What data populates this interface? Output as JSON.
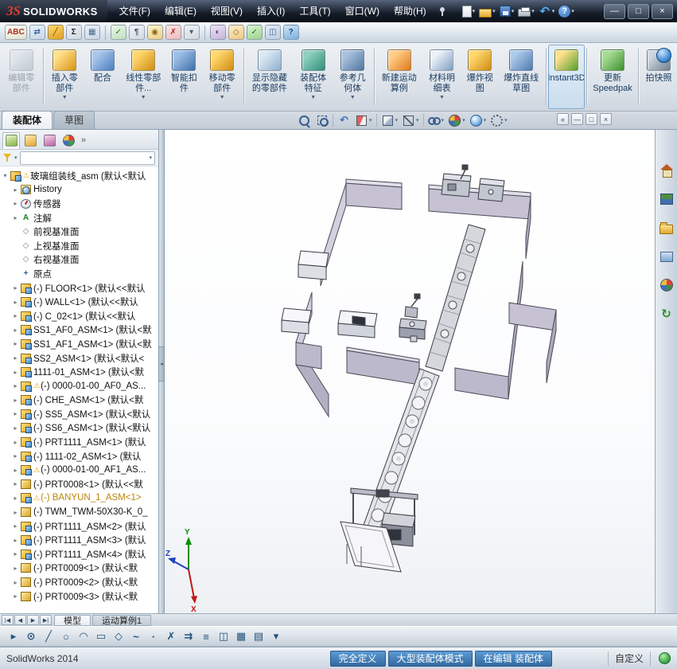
{
  "glyphs": {
    "expand": "▸",
    "expanded": "▾",
    "warning": "⚠",
    "dropdown": "▼",
    "small_dropdown": "▾",
    "overflow": "»",
    "splitter": "◂"
  },
  "titlebar": {
    "logo_mark": "ЗS",
    "logo_text": "SOLIDWORKS",
    "menus": [
      "文件(F)",
      "编辑(E)",
      "视图(V)",
      "插入(I)",
      "工具(T)",
      "窗口(W)",
      "帮助(H)"
    ],
    "quick_tools": [
      {
        "name": "new-document-icon",
        "cls": "qi-new",
        "dropdown": true
      },
      {
        "name": "open-document-icon",
        "cls": "qi-open",
        "dropdown": true
      },
      {
        "name": "save-icon",
        "cls": "qi-save",
        "dropdown": true
      },
      {
        "name": "print-icon",
        "cls": "qi-print",
        "dropdown": true
      },
      {
        "name": "undo-icon",
        "cls": "qi-undo",
        "glyph": "↶",
        "dropdown": true
      },
      {
        "name": "help-icon",
        "cls": "qi-help",
        "glyph": "?",
        "dropdown": true
      }
    ],
    "window_buttons": [
      {
        "name": "minimize-button",
        "glyph": "—"
      },
      {
        "name": "maximize-button",
        "glyph": "□"
      },
      {
        "name": "close-button",
        "glyph": "×"
      }
    ]
  },
  "toolbar2": {
    "icons": [
      {
        "name": "spell-checker-icon",
        "glyph": "ABC",
        "bg": "#fbfbf4",
        "bg2": "#e2e2d2",
        "fg": "#b03020"
      },
      {
        "name": "translate-icon",
        "glyph": "⇄",
        "bg": "#eaf0f8",
        "bg2": "#c8d6e6",
        "fg": "#2f5f9f"
      },
      {
        "name": "measure-icon",
        "glyph": "╱",
        "bg": "#ffd86e",
        "bg2": "#e0a020",
        "fg": "#7a4a00"
      },
      {
        "name": "mass-properties-icon",
        "glyph": "Σ",
        "bg": "#f0f3f7",
        "bg2": "#cfd8e2",
        "fg": "#222222"
      },
      {
        "name": "performance-evaluation-icon",
        "glyph": "▦",
        "bg": "#eaf0f8",
        "bg2": "#c8d6e6",
        "fg": "#4a6a8a"
      },
      {
        "sep": true
      },
      {
        "name": "verification-icon",
        "glyph": "✓",
        "bg": "#eaf6ea",
        "bg2": "#bfe0bf",
        "fg": "#1f7f1f"
      },
      {
        "name": "statistics-icon",
        "glyph": "¶",
        "bg": "#f2f4f7",
        "bg2": "#d4dbe2",
        "fg": "#44566a"
      },
      {
        "name": "interference-detection-icon",
        "glyph": "◉",
        "bg": "#fff3d0",
        "bg2": "#eccf8a",
        "fg": "#8a6a10"
      },
      {
        "name": "clearance-check-icon",
        "glyph": "✗",
        "bg": "#fbe4e4",
        "bg2": "#eebcbc",
        "fg": "#b02020"
      },
      {
        "name": "selection-options-icon",
        "glyph": "▾",
        "bg": "#eef1f5",
        "bg2": "#d2d9e0",
        "fg": "#4a5a6a"
      },
      {
        "sep": true
      },
      {
        "name": "appearance-filter-icon",
        "glyph": "◐",
        "bg": "#ece4f4",
        "bg2": "#c8b4dc",
        "fg": "#5a3a7a"
      },
      {
        "name": "assembly-transparency-icon",
        "glyph": "◇",
        "bg": "#fdeecb",
        "bg2": "#eeca84",
        "fg": "#8a5a10"
      },
      {
        "name": "check-active-document-icon",
        "glyph": "✓",
        "bg": "#d8f2d0",
        "bg2": "#9fd48e",
        "fg": "#1f6f1f"
      },
      {
        "name": "compare-documents-icon",
        "glyph": "◫",
        "bg": "#e4ecf6",
        "bg2": "#bcCEe4",
        "fg": "#3f5f8f"
      },
      {
        "name": "quick-tips-icon",
        "glyph": "?",
        "bg": "#cfe6f8",
        "bg2": "#7fb0dc",
        "fg": "#114a7f"
      }
    ]
  },
  "ribbon": {
    "buttons": [
      {
        "id": "edit-component",
        "label": "编辑零部件",
        "c1": "#d8dfe6",
        "c2": "#98a6b2",
        "disabled": true,
        "sep": true
      },
      {
        "id": "insert-components",
        "label": "插入零部件",
        "c1": "#ffe089",
        "c2": "#d89416",
        "dropdown": true
      },
      {
        "id": "mate",
        "label": "配合",
        "c1": "#a9c7ea",
        "c2": "#4a7fc0"
      },
      {
        "id": "linear-component-pattern",
        "label": "线性零部件...",
        "c1": "#ffd86e",
        "c2": "#cf8c12",
        "dropdown": true
      },
      {
        "id": "smart-fasteners",
        "label": "智能扣件",
        "c1": "#9fc0e8",
        "c2": "#3f6fa8"
      },
      {
        "id": "move-component",
        "label": "移动零部件",
        "c1": "#ffd86e",
        "c2": "#cf8c12",
        "dropdown": true,
        "sep": true
      },
      {
        "id": "show-hidden-components",
        "label": "显示隐藏的零部件",
        "c1": "#dce8f4",
        "c2": "#8fb0cc"
      },
      {
        "id": "assembly-features",
        "label": "装配体特征",
        "c1": "#8fd0c0",
        "c2": "#2f8f78",
        "dropdown": true
      },
      {
        "id": "reference-geometry",
        "label": "参考几何体",
        "c1": "#a9c0dc",
        "c2": "#50789f",
        "dropdown": true,
        "sep": true
      },
      {
        "id": "new-motion-study",
        "label": "新建运动算例",
        "c1": "#ffd089",
        "c2": "#e07818"
      },
      {
        "id": "bill-of-materials",
        "label": "材料明细表",
        "c1": "#eef2f8",
        "c2": "#7f9fc4",
        "dropdown": true
      },
      {
        "id": "exploded-view",
        "label": "爆炸视图",
        "c1": "#ffd86e",
        "c2": "#cf8c12"
      },
      {
        "id": "explode-line-sketch",
        "label": "爆炸直线草图",
        "c1": "#abc9e9",
        "c2": "#4f7ab0",
        "sep": true
      },
      {
        "id": "instant3d",
        "label": "Instant3D",
        "c1": "#ffe089",
        "c2": "#55a030",
        "active": true,
        "sep": true
      },
      {
        "id": "update-speedpak",
        "label": "更新 Speedpak",
        "c1": "#a8dc96",
        "c2": "#3f9030",
        "sep": true
      },
      {
        "id": "take-snapshot",
        "label": "拍快照",
        "c1": "#cdd5de",
        "c2": "#72818f"
      }
    ]
  },
  "tabs": {
    "document_tabs": [
      {
        "id": "assembly",
        "label": "装配体",
        "active": true
      },
      {
        "id": "sketch",
        "label": "草图",
        "active": false
      }
    ]
  },
  "viewport_toolbar": {
    "icons": [
      {
        "id": "zoom-fit",
        "name": "zoom-fit-icon"
      },
      {
        "id": "zoom-area",
        "name": "zoom-to-area-icon"
      },
      {
        "sep": true
      },
      {
        "id": "prev",
        "name": "previous-view-icon",
        "glyph": "↶"
      },
      {
        "id": "section",
        "name": "section-view-icon",
        "dropdown": true
      },
      {
        "sep": true
      },
      {
        "id": "orient",
        "name": "view-orientation-icon",
        "dropdown": true
      },
      {
        "id": "style",
        "name": "display-style-icon",
        "dropdown": true
      },
      {
        "sep": true
      },
      {
        "id": "hideshow",
        "name": "hide-show-items-icon",
        "dropdown": true
      },
      {
        "id": "appearance",
        "name": "edit-appearance-icon",
        "dropdown": true
      },
      {
        "id": "scene",
        "name": "apply-scene-icon",
        "dropdown": true
      },
      {
        "id": "settings",
        "name": "view-settings-icon",
        "dropdown": true
      }
    ]
  },
  "doc_controls": [
    {
      "name": "doc-pane-button",
      "glyph": "«"
    },
    {
      "name": "doc-minimize-button",
      "glyph": "—"
    },
    {
      "name": "doc-restore-button",
      "glyph": "□"
    },
    {
      "name": "doc-close-button",
      "glyph": "×"
    }
  ],
  "left_panel": {
    "manager_tabs": [
      {
        "name": "feature-manager-tab",
        "icon": "feature-manager-icon",
        "cls": "mi-fm",
        "active": true
      },
      {
        "name": "property-manager-tab",
        "icon": "property-manager-icon",
        "cls": "mi-pm"
      },
      {
        "name": "configuration-manager-tab",
        "icon": "configuration-manager-icon",
        "cls": "mi-cm"
      },
      {
        "name": "display-manager-tab",
        "icon": "display-manager-icon",
        "cls": "mi-dm"
      }
    ],
    "overflow": "»"
  },
  "tree": {
    "root": {
      "label": "玻璃组装线_asm (默认<默认",
      "warning": true
    },
    "icon_glyphs": {
      "annotation": "A",
      "plane": "◇",
      "origin": "+"
    },
    "items": [
      {
        "icon": "history",
        "label": "History",
        "expand": true
      },
      {
        "icon": "sensor",
        "label": "传感器",
        "expand": true
      },
      {
        "icon": "annotation",
        "label": "注解",
        "expand": true
      },
      {
        "icon": "plane",
        "label": "前视基准面"
      },
      {
        "icon": "plane",
        "label": "上视基准面"
      },
      {
        "icon": "plane",
        "label": "右视基准面"
      },
      {
        "icon": "origin",
        "label": "原点"
      },
      {
        "icon": "assembly",
        "label": "(-) FLOOR<1> (默认<<默认",
        "expand": true
      },
      {
        "icon": "assembly",
        "label": "(-) WALL<1> (默认<<默认",
        "expand": true
      },
      {
        "icon": "assembly",
        "label": "(-) C_02<1> (默认<<默认",
        "expand": true
      },
      {
        "icon": "assembly",
        "label": "SS1_AF0_ASM<1> (默认<默",
        "expand": true
      },
      {
        "icon": "assembly",
        "label": "SS1_AF1_ASM<1> (默认<默",
        "expand": true
      },
      {
        "icon": "assembly",
        "label": "SS2_ASM<1> (默认<默认<",
        "expand": true
      },
      {
        "icon": "assembly",
        "label": "1111-01_ASM<1> (默认<默",
        "expand": true
      },
      {
        "icon": "assembly",
        "label": "(-) 0000-01-00_AF0_AS...",
        "expand": true,
        "warning": true
      },
      {
        "icon": "assembly",
        "label": "(-) CHE_ASM<1> (默认<默",
        "expand": true
      },
      {
        "icon": "assembly",
        "label": "(-) SS5_ASM<1> (默认<默认",
        "expand": true
      },
      {
        "icon": "assembly",
        "label": "(-) SS6_ASM<1> (默认<默认",
        "expand": true
      },
      {
        "icon": "assembly",
        "label": "(-) PRT1111_ASM<1> (默认",
        "expand": true
      },
      {
        "icon": "assembly",
        "label": "(-) 1111-02_ASM<1> (默认",
        "expand": true
      },
      {
        "icon": "assembly",
        "label": "(-) 0000-01-00_AF1_AS...",
        "expand": true,
        "warning": true
      },
      {
        "icon": "part",
        "label": "(-) PRT0008<1> (默认<<默",
        "expand": true
      },
      {
        "icon": "assembly",
        "label": "(-) BANYUN_1_ASM<1>",
        "expand": true,
        "warning": true,
        "color": "#b8860b"
      },
      {
        "icon": "part",
        "label": "(-) TWM_TWM-50X30-K_0_",
        "expand": true
      },
      {
        "icon": "assembly",
        "label": "(-) PRT1111_ASM<2> (默认",
        "expand": true
      },
      {
        "icon": "assembly",
        "label": "(-) PRT1111_ASM<3> (默认",
        "expand": true
      },
      {
        "icon": "assembly",
        "label": "(-) PRT1111_ASM<4> (默认",
        "expand": true
      },
      {
        "icon": "part",
        "label": "(-) PRT0009<1> (默认<默",
        "expand": true
      },
      {
        "icon": "part",
        "label": "(-) PRT0009<2> (默认<默",
        "expand": true
      },
      {
        "icon": "part",
        "label": "(-) PRT0009<3> (默认<默",
        "expand": true
      }
    ]
  },
  "bottom_tabs": {
    "nav": [
      "|◀",
      "◀",
      "▶",
      "▶|"
    ],
    "tabs": [
      {
        "id": "model",
        "label": "模型",
        "active": true
      },
      {
        "id": "motion-study-1",
        "label": "运动算例1",
        "active": false
      }
    ]
  },
  "sketch_toolbar": {
    "icons": [
      {
        "name": "select-icon",
        "glyph": "▸"
      },
      {
        "name": "smart-dimension-icon",
        "glyph": "⊙"
      },
      {
        "name": "line-icon",
        "glyph": "╱"
      },
      {
        "name": "circle-icon",
        "glyph": "○"
      },
      {
        "name": "arc-icon",
        "glyph": "◠"
      },
      {
        "name": "rectangle-icon",
        "glyph": "▭"
      },
      {
        "name": "polygon-icon",
        "glyph": "◇"
      },
      {
        "name": "spline-icon",
        "glyph": "~"
      },
      {
        "name": "point-icon",
        "glyph": "·"
      },
      {
        "name": "trim-entities-icon",
        "glyph": "✗"
      },
      {
        "name": "convert-entities-icon",
        "glyph": "⇉"
      },
      {
        "name": "offset-entities-icon",
        "glyph": "≡"
      },
      {
        "name": "mirror-entities-icon",
        "glyph": "◫"
      },
      {
        "name": "linear-sketch-pattern-icon",
        "glyph": "▦"
      },
      {
        "name": "grid-icon",
        "glyph": "▤"
      },
      {
        "name": "more-sketch-tools-icon",
        "glyph": "▾"
      }
    ]
  },
  "task_pane": {
    "icons": [
      {
        "name": "solidworks-resources-icon",
        "cls": "tpi-house"
      },
      {
        "name": "design-library-icon",
        "cls": "tpi-books"
      },
      {
        "name": "file-explorer-icon",
        "cls": "tpi-folder"
      },
      {
        "name": "view-palette-icon",
        "cls": "tpi-palette"
      },
      {
        "name": "appearances-scenes-icon",
        "cls": "tpi-ball"
      },
      {
        "name": "custom-properties-icon",
        "cls": "tpi-recycle",
        "glyph": "↻"
      }
    ]
  },
  "statusbar": {
    "app": "SolidWorks 2014",
    "segments": [
      "完全定义",
      "大型装配体模式",
      "在编辑 装配体"
    ],
    "custom": "自定义"
  },
  "triad": {
    "x": "X",
    "y": "Y",
    "z": "Z"
  },
  "colors": {
    "accent_blue": "#3f76ad",
    "warning_yellow": "#e89b00",
    "wall_fill": "#c6c2d4",
    "status_green": "#3fae49",
    "logo_red": "#e23c32"
  }
}
